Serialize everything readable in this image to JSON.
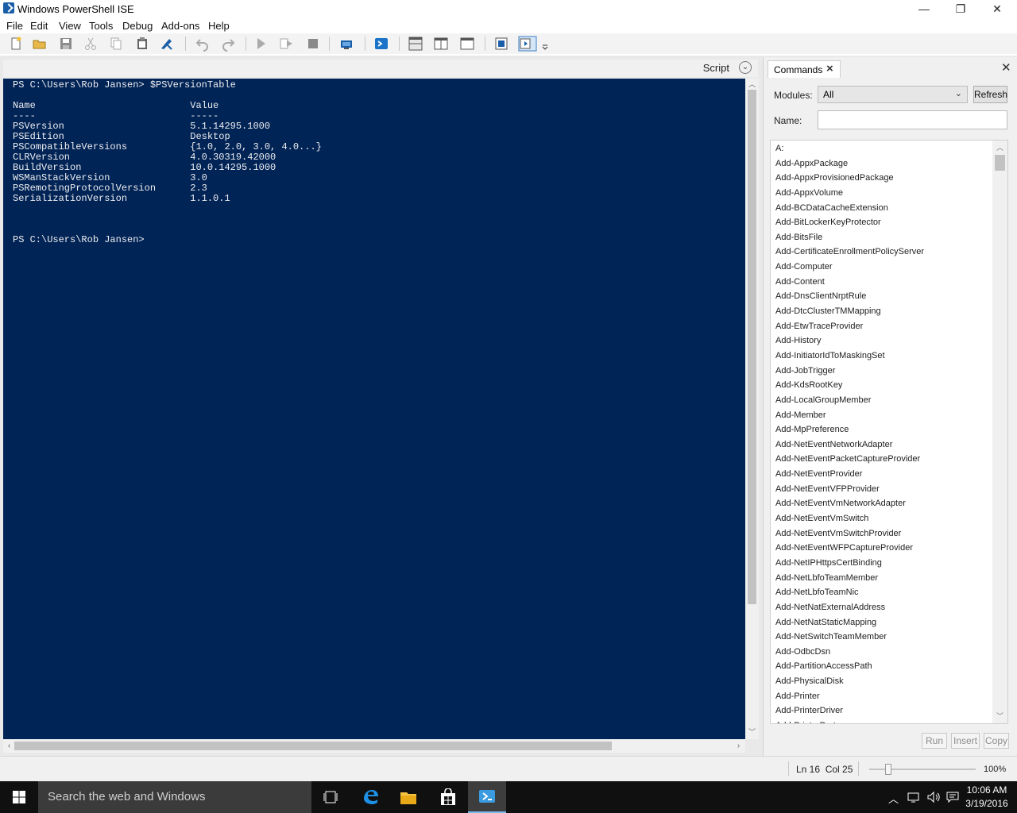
{
  "window": {
    "title": "Windows PowerShell ISE",
    "minimize_glyph": "—",
    "restore_glyph": "❐",
    "close_glyph": "✕"
  },
  "menu": [
    "File",
    "Edit",
    "View",
    "Tools",
    "Debug",
    "Add-ons",
    "Help"
  ],
  "toolbar_icons": [
    "new-file-icon",
    "open-folder-icon",
    "save-icon",
    "cut-icon",
    "copy-icon",
    "paste-icon",
    "clear-console-icon",
    "undo-icon",
    "redo-icon",
    "run-icon",
    "run-selection-icon",
    "stop-icon",
    "remote-tab-icon",
    "start-powershell-icon",
    "layout-top-icon",
    "layout-right-icon",
    "layout-max-icon",
    "show-commands-icon",
    "show-addon-icon"
  ],
  "script_header": {
    "label": "Script"
  },
  "console": {
    "lines": [
      "PS C:\\Users\\Rob Jansen> $PSVersionTable",
      "",
      "Name                           Value",
      "----                           -----",
      "PSVersion                      5.1.14295.1000",
      "PSEdition                      Desktop",
      "PSCompatibleVersions           {1.0, 2.0, 3.0, 4.0...}",
      "CLRVersion                     4.0.30319.42000",
      "BuildVersion                   10.0.14295.1000",
      "WSManStackVersion              3.0",
      "PSRemotingProtocolVersion      2.3",
      "SerializationVersion           1.1.0.1",
      "",
      "",
      "",
      "PS C:\\Users\\Rob Jansen>"
    ]
  },
  "commands": {
    "tab_label": "Commands",
    "modules_label": "Modules:",
    "modules_value": "All",
    "refresh_label": "Refresh",
    "name_label": "Name:",
    "name_value": "",
    "items": [
      "A:",
      "Add-AppxPackage",
      "Add-AppxProvisionedPackage",
      "Add-AppxVolume",
      "Add-BCDataCacheExtension",
      "Add-BitLockerKeyProtector",
      "Add-BitsFile",
      "Add-CertificateEnrollmentPolicyServer",
      "Add-Computer",
      "Add-Content",
      "Add-DnsClientNrptRule",
      "Add-DtcClusterTMMapping",
      "Add-EtwTraceProvider",
      "Add-History",
      "Add-InitiatorIdToMaskingSet",
      "Add-JobTrigger",
      "Add-KdsRootKey",
      "Add-LocalGroupMember",
      "Add-Member",
      "Add-MpPreference",
      "Add-NetEventNetworkAdapter",
      "Add-NetEventPacketCaptureProvider",
      "Add-NetEventProvider",
      "Add-NetEventVFPProvider",
      "Add-NetEventVmNetworkAdapter",
      "Add-NetEventVmSwitch",
      "Add-NetEventVmSwitchProvider",
      "Add-NetEventWFPCaptureProvider",
      "Add-NetIPHttpsCertBinding",
      "Add-NetLbfoTeamMember",
      "Add-NetLbfoTeamNic",
      "Add-NetNatExternalAddress",
      "Add-NetNatStaticMapping",
      "Add-NetSwitchTeamMember",
      "Add-OdbcDsn",
      "Add-PartitionAccessPath",
      "Add-PhysicalDisk",
      "Add-Printer",
      "Add-PrinterDriver",
      "Add-PrinterPort"
    ],
    "run_label": "Run",
    "insert_label": "Insert",
    "copy_label": "Copy"
  },
  "status": {
    "ln": "Ln 16",
    "col": "Col 25",
    "zoom": "100%",
    "zoom_fraction": 0.18
  },
  "taskbar": {
    "search_placeholder": "Search the web and Windows",
    "time": "10:06 AM",
    "date": "3/19/2016",
    "pinned_icons": [
      "task-view-icon",
      "edge-icon",
      "file-explorer-icon",
      "store-icon",
      "powershell-ise-icon"
    ],
    "tray_icons": [
      "chevron-up-icon",
      "network-icon",
      "volume-icon",
      "action-center-icon"
    ]
  },
  "colors": {
    "console_bg": "#012456",
    "console_fg": "#eeedf0",
    "accent": "#76b9ed"
  }
}
